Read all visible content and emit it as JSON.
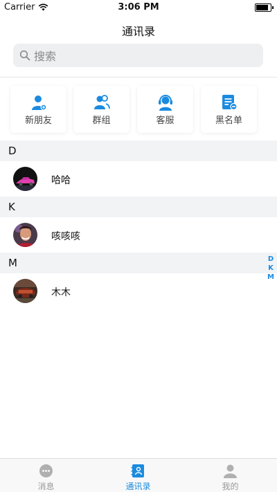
{
  "status": {
    "carrier": "Carrier",
    "time": "3:06 PM"
  },
  "nav": {
    "title": "通讯录"
  },
  "search": {
    "placeholder": "搜索"
  },
  "shortcuts": [
    {
      "label": "新朋友",
      "icon": "new-friend-icon"
    },
    {
      "label": "群组",
      "icon": "group-icon"
    },
    {
      "label": "客服",
      "icon": "customer-service-icon"
    },
    {
      "label": "黑名单",
      "icon": "blacklist-icon"
    }
  ],
  "sections": [
    {
      "letter": "D",
      "contacts": [
        {
          "name": "哈哈"
        }
      ]
    },
    {
      "letter": "K",
      "contacts": [
        {
          "name": "咳咳咳"
        }
      ]
    },
    {
      "letter": "M",
      "contacts": [
        {
          "name": "木木"
        }
      ]
    }
  ],
  "index": [
    "D",
    "K",
    "M"
  ],
  "tabs": [
    {
      "label": "消息",
      "icon": "message-icon",
      "active": false
    },
    {
      "label": "通讯录",
      "icon": "contacts-icon",
      "active": true
    },
    {
      "label": "我的",
      "icon": "profile-icon",
      "active": false
    }
  ],
  "colors": {
    "accent": "#1b8be0",
    "section_bg": "#f2f3f5"
  }
}
